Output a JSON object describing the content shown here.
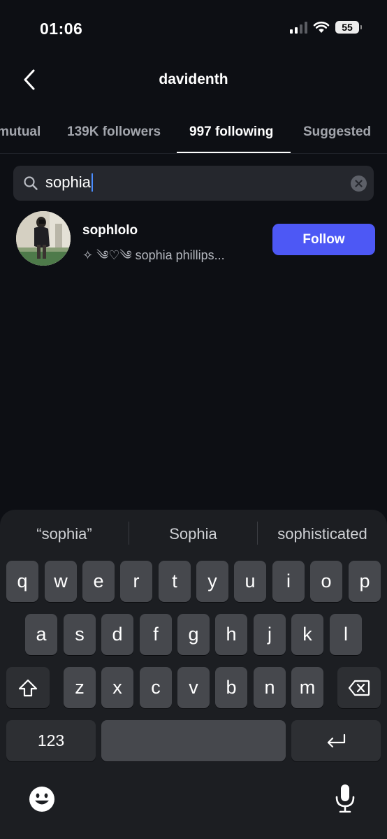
{
  "status_bar": {
    "time": "01:06",
    "battery": "55"
  },
  "header": {
    "title": "davidenth"
  },
  "tabs": [
    {
      "label": "mutual"
    },
    {
      "label": "139K followers"
    },
    {
      "label": "997 following"
    },
    {
      "label": "Suggested"
    }
  ],
  "search": {
    "value": "sophia"
  },
  "result": {
    "username": "sophlolo",
    "bio": "✧ ༄♡༄ sophia phillips...",
    "follow_label": "Follow"
  },
  "keyboard": {
    "suggestions": [
      "“sophia”",
      "Sophia",
      "sophisticated"
    ],
    "row1": [
      "q",
      "w",
      "e",
      "r",
      "t",
      "y",
      "u",
      "i",
      "o",
      "p"
    ],
    "row2": [
      "a",
      "s",
      "d",
      "f",
      "g",
      "h",
      "j",
      "k",
      "l"
    ],
    "row3": [
      "z",
      "x",
      "c",
      "v",
      "b",
      "n",
      "m"
    ],
    "numbers_label": "123"
  },
  "colors": {
    "accent": "#4d58f5",
    "background": "#0d0f14",
    "key": "#46484d"
  }
}
